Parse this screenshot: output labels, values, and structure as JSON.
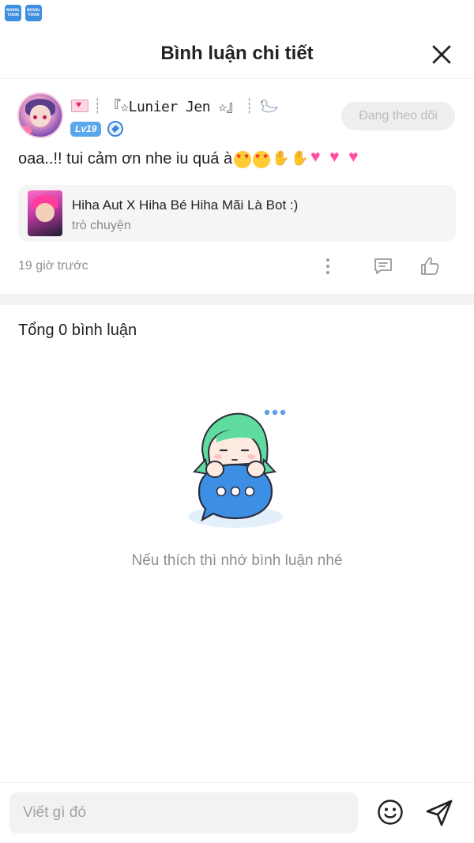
{
  "status_bar": {
    "apps": [
      {
        "name": "NOVEL TOON",
        "icon": "noveltoon-app-icon"
      },
      {
        "name": "NOVEL TOON",
        "icon": "noveltoon-app-icon"
      }
    ]
  },
  "header": {
    "title": "Bình luận chi tiết",
    "close_icon": "close-icon"
  },
  "comment": {
    "username": "『☆Lunier Jen ☆』",
    "name_prefix": "┊",
    "name_suffix": "┊",
    "level": "Lv19",
    "follow_label": "Đang theo dõi",
    "text": "oaa..!! tui cảm ơn nhe iu quá à",
    "emojis": [
      "heart-eyes",
      "heart-eyes",
      "raised-hands",
      "raised-hands",
      "pink-heart",
      "pink-heart",
      "pink-heart"
    ],
    "story": {
      "title": "Hiha Aut X Hiha Bé Hiha Mãi Là Bot :)",
      "subtitle": "trò chuyện"
    },
    "timestamp": "19 giờ trước"
  },
  "comments_section": {
    "total_label": "Tổng 0 bình luận",
    "empty_text": "Nếu thích thì nhớ bình luận nhé"
  },
  "input_bar": {
    "placeholder": "Viết gì đó"
  },
  "colors": {
    "accent_blue": "#3b86d6",
    "level_badge": "#5aa8ec",
    "follow_bg": "#eeeeee",
    "follow_text": "#bdbdbd",
    "muted_text": "#8f8f8f"
  }
}
